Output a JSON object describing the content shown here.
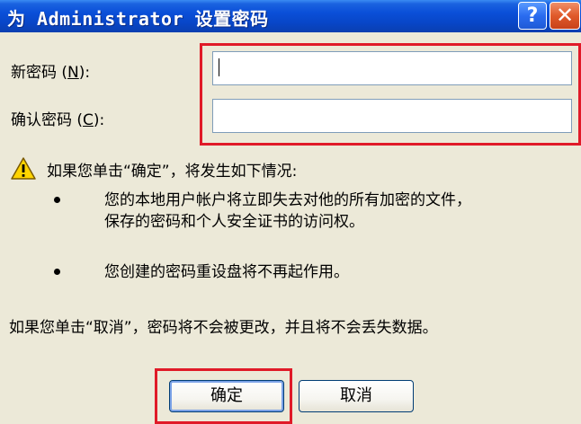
{
  "dialog": {
    "title": "为 Administrator 设置密码",
    "help_button": "?",
    "close_button": "✕"
  },
  "form": {
    "new_password": {
      "label_prefix": "新密码 (",
      "accesskey": "N",
      "label_suffix": "):",
      "value": ""
    },
    "confirm_password": {
      "label_prefix": "确认密码 (",
      "accesskey": "C",
      "label_suffix": "):",
      "value": ""
    }
  },
  "warning": {
    "icon": "warning-icon",
    "intro": "如果您单击“确定”，将发生如下情况:",
    "bullets": [
      "您的本地用户帐户将立即失去对他的所有加密的文件，",
      "保存的密码和个人安全证书的访问权。",
      "您创建的密码重设盘将不再起作用。"
    ],
    "cancel_note": "如果您单击“取消”，密码将不会被更改，并且将不会丢失数据。"
  },
  "buttons": {
    "ok": "确定",
    "cancel": "取消"
  },
  "colors": {
    "titlebar": "#0846c8",
    "highlight": "#e01a28",
    "dialog_bg": "#ece9d8"
  }
}
